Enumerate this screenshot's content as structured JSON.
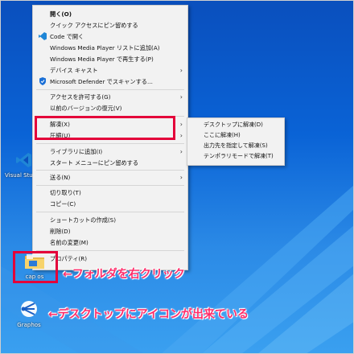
{
  "context_menu": {
    "items": [
      {
        "label": "開く(O)",
        "bold": true,
        "icon": ""
      },
      {
        "label": "クイック アクセスにピン留めする",
        "icon": ""
      },
      {
        "label": "Code で開く",
        "icon": "vscode-icon"
      },
      {
        "label": "Windows Media Player リストに追加(A)",
        "icon": ""
      },
      {
        "label": "Windows Media Player で再生する(P)",
        "icon": ""
      },
      {
        "label": "デバイス キャスト",
        "icon": "",
        "arrow": true
      },
      {
        "label": "Microsoft Defender でスキャンする...",
        "icon": "defender-icon"
      },
      {
        "label": "アクセスを許可する(G)",
        "icon": "",
        "arrow": true
      },
      {
        "label": "以前のバージョンの復元(V)",
        "icon": ""
      },
      {
        "label": "解凍(X)",
        "icon": "",
        "arrow": true
      },
      {
        "label": "圧縮(U)",
        "icon": "",
        "arrow": true
      },
      {
        "label": "ライブラリに追加(I)",
        "icon": "",
        "arrow": true
      },
      {
        "label": "スタート メニューにピン留めする",
        "icon": ""
      },
      {
        "label": "送る(N)",
        "icon": "",
        "arrow": true
      },
      {
        "label": "切り取り(T)",
        "icon": ""
      },
      {
        "label": "コピー(C)",
        "icon": ""
      },
      {
        "label": "ショートカットの作成(S)",
        "icon": ""
      },
      {
        "label": "削除(D)",
        "icon": ""
      },
      {
        "label": "名前の変更(M)",
        "icon": ""
      },
      {
        "label": "プロパティ(R)",
        "icon": ""
      }
    ]
  },
  "submenu": {
    "items": [
      "デスクトップに解凍(D)",
      "ここに解凍(H)",
      "出力先を指定して解凍(S)",
      "テンポラリモードで解凍(T)"
    ]
  },
  "desktop": {
    "icon_vs_label": "Visual Studio Code",
    "folder_label": "cap os",
    "shortcut_label": "Graphos"
  },
  "annotations": {
    "folder_note": "←フォルダを右クリック",
    "shortcut_note": "←デスクトップにアイコンが出来ている"
  },
  "colors": {
    "highlight": "#e4003a",
    "annotation": "#ff2d6a"
  }
}
